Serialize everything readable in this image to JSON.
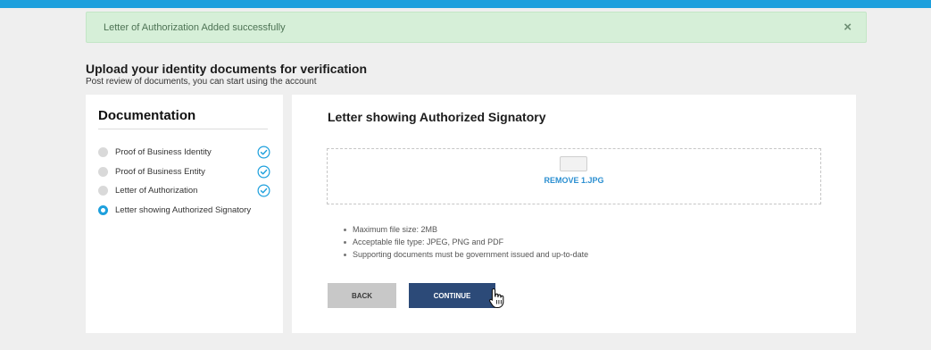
{
  "alert": {
    "message": "Letter of Authorization Added successfully",
    "close_glyph": "×"
  },
  "header": {
    "title": "Upload your identity documents for verification",
    "subtitle": "Post review of documents, you can start using the account"
  },
  "sidebar": {
    "title": "Documentation",
    "items": [
      {
        "label": "Proof of Business Identity",
        "state": "done",
        "icon": "check-circle-icon"
      },
      {
        "label": "Proof of Business Entity",
        "state": "done",
        "icon": "check-circle-icon"
      },
      {
        "label": "Letter of Authorization",
        "state": "done",
        "icon": "check-circle-icon"
      },
      {
        "label": "Letter showing Authorized Signatory",
        "state": "active",
        "icon": ""
      }
    ]
  },
  "main": {
    "title": "Letter showing Authorized Signatory",
    "upload": {
      "remove_label": "REMOVE 1.JPG",
      "thumbnail_icon": "file-thumbnail-icon"
    },
    "rules": [
      "Maximum file size: 2MB",
      "Acceptable file type: JPEG, PNG and PDF",
      "Supporting documents must be government issued and up-to-date"
    ],
    "buttons": {
      "back": "BACK",
      "continue": "CONTINUE"
    }
  },
  "colors": {
    "accent": "#1ea0dd",
    "success_bg": "#d6efd8",
    "primary_button": "#2c4a78",
    "secondary_button": "#c8c8c8",
    "link": "#2b8fd1"
  }
}
